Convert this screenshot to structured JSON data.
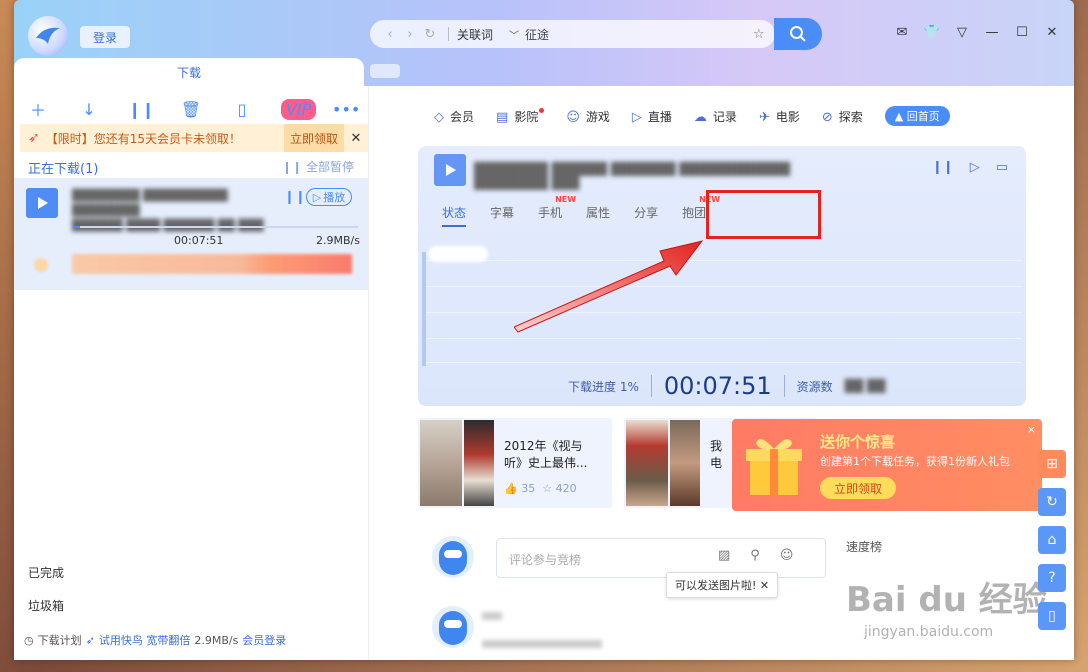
{
  "titlebar": {
    "login_label": "登录",
    "address": {
      "keyword": "关联词",
      "query": "征途"
    },
    "download_tab": "下载"
  },
  "toolbar": {
    "vip_label": "VIP"
  },
  "promo": {
    "text": "【限时】您还有15天会员卡未领取！",
    "claim": "立即领取",
    "close": "✕"
  },
  "downloading": {
    "header": "正在下载(1)",
    "pause_all": "全部暂停",
    "item": {
      "play_label": "播放",
      "elapsed": "00:07:51",
      "speed": "2.9MB/s",
      "progress": 1
    }
  },
  "sidebar_bottom": {
    "completed": "已完成",
    "trash": "垃圾箱"
  },
  "footer": {
    "plan": "下载计划",
    "trial": "试用快鸟 宽带翻倍",
    "speed": "2.9MB/s",
    "member_login": "会员登录"
  },
  "nav": [
    {
      "icon": "diamond-icon",
      "label": "会员"
    },
    {
      "icon": "film-icon",
      "label": "影院"
    },
    {
      "icon": "game-icon",
      "label": "游戏"
    },
    {
      "icon": "tv-icon",
      "label": "直播"
    },
    {
      "icon": "cloud-icon",
      "label": "记录"
    },
    {
      "icon": "movie-icon",
      "label": "电影"
    },
    {
      "icon": "explore-icon",
      "label": "探索"
    }
  ],
  "nav_home": "回首页",
  "panel": {
    "tabs": [
      {
        "label": "状态",
        "new": ""
      },
      {
        "label": "字幕",
        "new": ""
      },
      {
        "label": "手机",
        "new": "NEW"
      },
      {
        "label": "属性",
        "new": ""
      },
      {
        "label": "分享",
        "new": ""
      },
      {
        "label": "抱团",
        "new": "NEW"
      }
    ],
    "progress_label": "下载进度 1%",
    "time": "00:07:51",
    "resource_label": "资源数"
  },
  "cards": [
    {
      "title_line1": "2012年《视与",
      "title_line2": "听》史上最伟...",
      "likes": "35",
      "stars": "420"
    },
    {
      "title_line1": "我",
      "title_line2": "电"
    }
  ],
  "gift": {
    "title": "送你个惊喜",
    "subtitle": "创建第1个下载任务，获得1份新人礼包",
    "claim": "立即领取",
    "close": "×"
  },
  "comment": {
    "placeholder": "评论参与竞榜",
    "tooltip": "可以发送图片啦!",
    "tooltip_close": "✕"
  },
  "speed_rank": "速度榜",
  "watermark": {
    "main": "Bai du 经验",
    "sub": "jingyan.baidu.com"
  }
}
